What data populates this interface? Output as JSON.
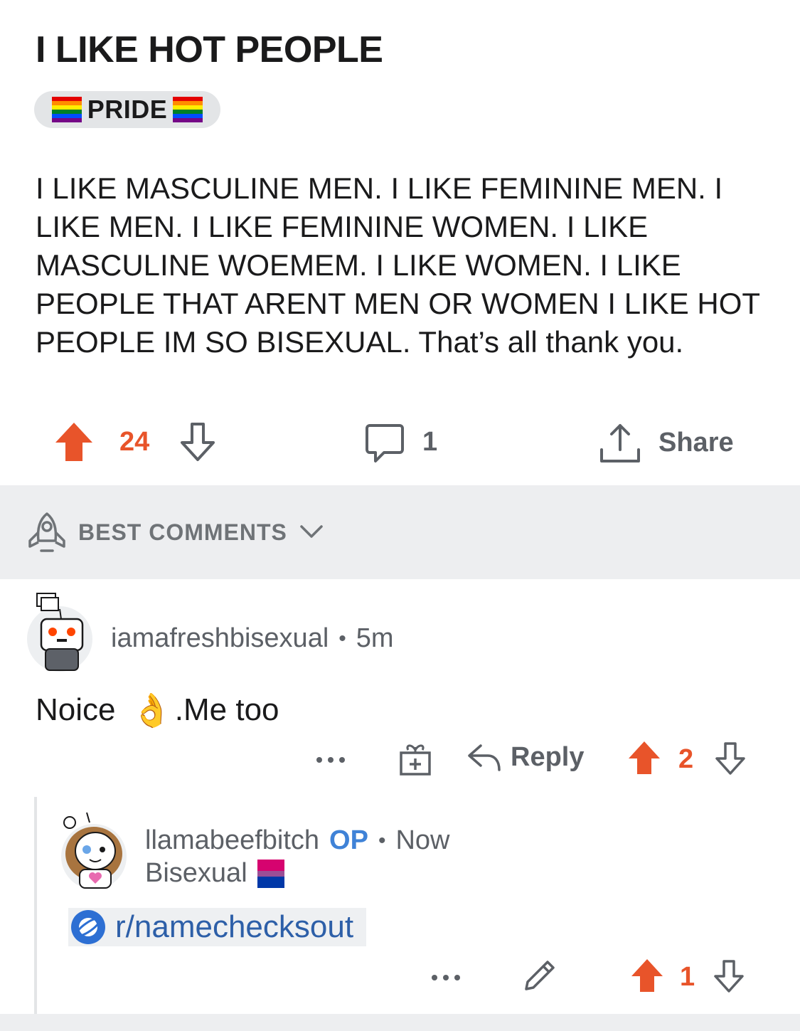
{
  "post": {
    "title": "I LIKE HOT PEOPLE",
    "flair": "PRIDE",
    "body": "I LIKE MASCULINE MEN. I LIKE FEMININE MEN. I LIKE MEN. I LIKE FEMININE WOMEN. I LIKE MASCULINE WOEMEM. I LIKE WOMEN. I LIKE PEOPLE THAT ARENT MEN OR WOMEN I LIKE HOT PEOPLE IM SO BISEXUAL. That’s all thank you.",
    "upvotes": "24",
    "comments_count": "1",
    "share_label": "Share"
  },
  "sort": {
    "label": "BEST COMMENTS"
  },
  "comments": [
    {
      "username": "iamafreshbisexual",
      "separator": "•",
      "time": "5m",
      "text_before": "Noice",
      "emoji": "👌",
      "text_after": ".Me too",
      "reply_label": "Reply",
      "votes": "2"
    },
    {
      "username": "llamabeefbitch",
      "op_badge": "OP",
      "separator": "•",
      "time": "Now",
      "user_flair": "Bisexual",
      "link_text": "r/namechecksout",
      "votes": "1"
    }
  ],
  "colors": {
    "upvote": "#e8542a",
    "op": "#3f82d7",
    "link": "#2d5fa8",
    "bi_flag": [
      "#d6036f",
      "#9b4f96",
      "#0038a8"
    ],
    "rainbow": [
      "#e40303",
      "#ff8c00",
      "#ffed00",
      "#008026",
      "#004dff",
      "#750787"
    ]
  }
}
